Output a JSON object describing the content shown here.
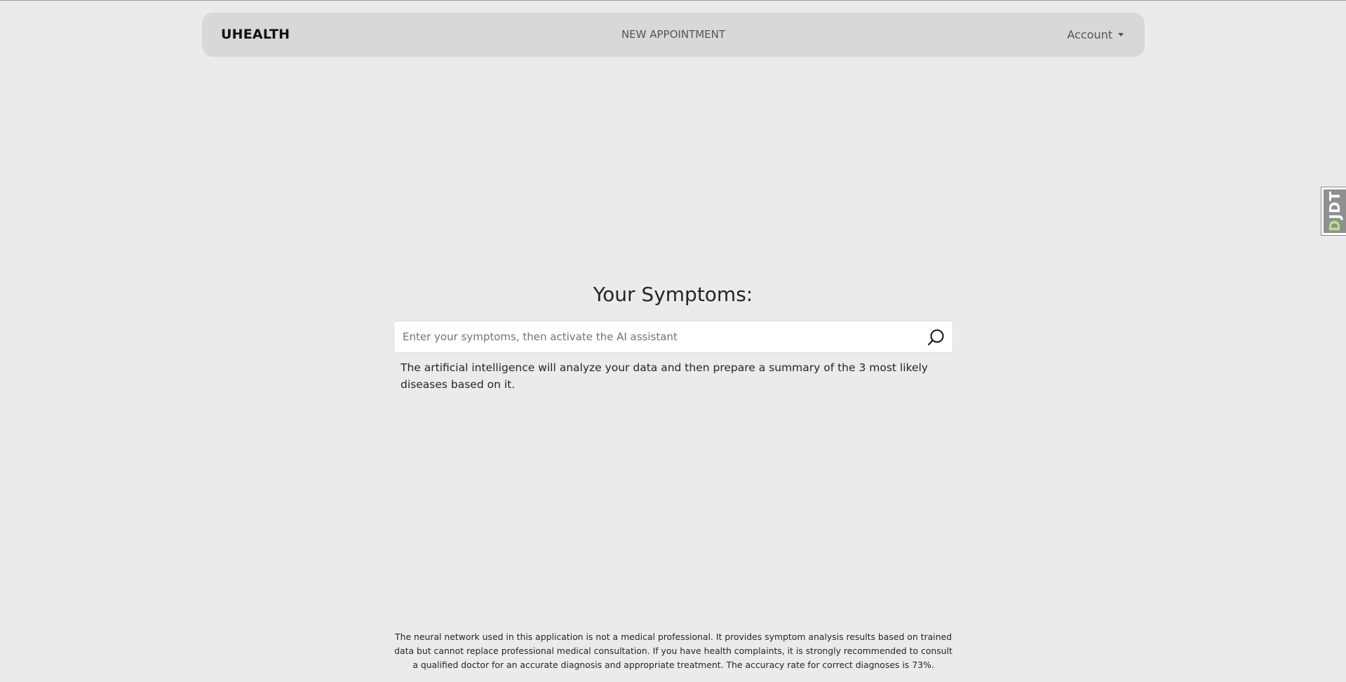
{
  "navbar": {
    "brand": "UHEALTH",
    "center_link": "NEW APPOINTMENT",
    "account_label": "Account"
  },
  "debug_toolbar": {
    "label_first": "D",
    "label_rest": "JDT"
  },
  "main": {
    "title": "Your Symptoms:",
    "search": {
      "placeholder": "Enter your symptoms, then activate the AI assistant",
      "value": "",
      "icon": "search-icon"
    },
    "description": "The artificial intelligence will analyze your data and then prepare a summary of the 3 most likely diseases based on it."
  },
  "footer": {
    "disclaimer": "The neural network used in this application is not a medical professional. It provides symptom analysis results based on trained data but cannot replace professional medical consultation. If you have health complaints, it is strongly recommended to consult a qualified doctor for an accurate diagnosis and appropriate treatment. The accuracy rate for correct diagnoses is 73%."
  },
  "colors": {
    "page_background": "#ebebeb",
    "navbar_background": "#d8d8d8",
    "text": "#212529",
    "muted": "#555555"
  }
}
